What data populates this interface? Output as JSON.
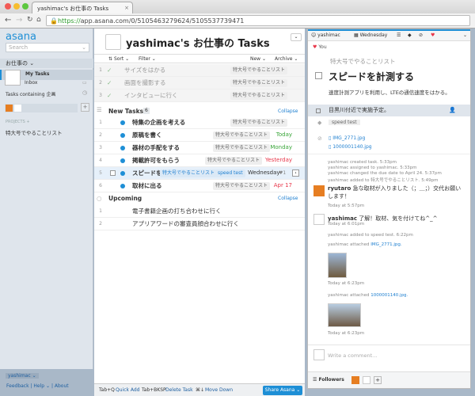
{
  "browser": {
    "tab_title": "yashimac's お仕事の Tasks",
    "url_scheme": "https://",
    "url_rest": "app.asana.com/0/5105463279624/5105537739471"
  },
  "sidebar": {
    "logo": "asana",
    "search_placeholder": "Search",
    "workspace": "お仕事の",
    "my_tasks": "My Tasks",
    "inbox": "Inbox",
    "tasks_containing": "Tasks containing 企画",
    "projects_label": "PROJECTS",
    "project": "特大号でやることリスト",
    "user": "yashimac",
    "feedback": "Feedback",
    "help": "Help",
    "about": "About"
  },
  "center": {
    "title": "yashimac's お仕事の Tasks",
    "sort": "Sort",
    "filter": "Filter",
    "new": "New",
    "archive": "Archive",
    "done": [
      {
        "n": "1",
        "name": "サイズをはかる",
        "tag": "特大号でやることリスト"
      },
      {
        "n": "2",
        "name": "画面を撮影する",
        "tag": "特大号でやることリスト"
      },
      {
        "n": "3",
        "name": "インタビューに行く",
        "tag": "特大号でやることリスト"
      }
    ],
    "new_tasks": {
      "label": "New Tasks",
      "count": "6",
      "collapse": "Collapse",
      "items": [
        {
          "n": "1",
          "name": "特集の企画を考える",
          "tag": "特大号でやることリスト",
          "due": "",
          "color": ""
        },
        {
          "n": "2",
          "name": "原稿を書く",
          "tag": "特大号でやることリスト",
          "due": "Today",
          "color": "#3aa63a"
        },
        {
          "n": "3",
          "name": "器材の手配をする",
          "tag": "特大号でやることリスト",
          "due": "Monday",
          "color": "#3aa63a"
        },
        {
          "n": "4",
          "name": "掲載許可をもらう",
          "tag": "特大号でやることリスト",
          "due": "Yesterday",
          "color": "#e8374a"
        },
        {
          "n": "5",
          "name": "スピードを",
          "tag": "特大号でやることリスト",
          "tag2": "speed test",
          "due": "Wednesday",
          "hearts": "1",
          "color": "#333"
        },
        {
          "n": "6",
          "name": "取材に出る",
          "tag": "特大号でやることリスト",
          "due": "Apr 17",
          "color": "#e8374a"
        }
      ]
    },
    "upcoming": {
      "label": "Upcoming",
      "collapse": "Collapse",
      "items": [
        {
          "n": "1",
          "name": "電子書籍企画の打ち合わせに行く"
        },
        {
          "n": "2",
          "name": "アプリアワードの審査員顔合わせに行く"
        }
      ]
    }
  },
  "footer": {
    "k1": "Tab+Q",
    "a1": "Quick Add",
    "k2": "Tab+BKSP",
    "a2": "Delete Task",
    "k3": "⌘↓",
    "a3": "Move Down",
    "share": "Share Asana"
  },
  "detail": {
    "assignee": "yashimac",
    "due": "Wednesday",
    "hearted": "You",
    "project": "特大号でやることリスト",
    "title": "スピードを計測する",
    "desc": "速度計測アプリを利用し、LTEの通信速度をはかる。",
    "subtask": "目黒川付近で実施予定。",
    "tag": "speed test",
    "att1": "IMG_2771.jpg",
    "att2": "1000001140.jpg",
    "activity": [
      "yashimac created task.   5:33pm",
      "yashimac assigned to yashimac.   5:33pm",
      "yashimac changed the due date to April 24.   5:37pm",
      "yashimac added to 特大号でやることリスト.   5:49pm"
    ],
    "c1_user": "ryutaro",
    "c1_text": "急な取材が入りました（；＿；）交代お願いします！",
    "c1_time": "Today at 5:57pm",
    "c2_user": "yashimac",
    "c2_text": "了解！取材、気を付けてね^_^",
    "c2_time": "Today at 6:01pm",
    "a5": "yashimac added to speed test.   6:22pm",
    "a6": "yashimac attached",
    "a6_link": "IMG_2771.jpg.",
    "a6_time": "Today at 6:23pm",
    "a7": "yashimac attached",
    "a7_link": "1000001140.jpg.",
    "a7_time": "Today at 6:23pm",
    "comment_placeholder": "Write a comment...",
    "followers": "Followers"
  }
}
